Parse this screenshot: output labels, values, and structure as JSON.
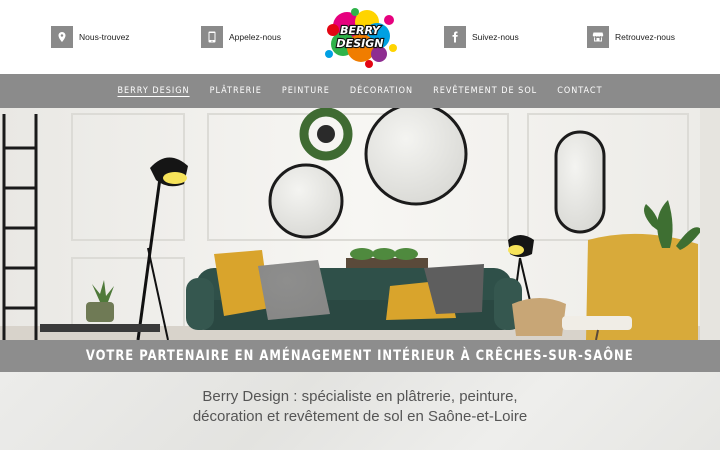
{
  "header": {
    "contacts": [
      {
        "label": "Nous-trouvez",
        "icon": "map-pin-icon"
      },
      {
        "label": "Appelez-nous",
        "icon": "phone-icon"
      },
      {
        "label": "Suivez-nous",
        "icon": "facebook-icon"
      },
      {
        "label": "Retrouvez-nous",
        "icon": "storefront-icon"
      }
    ],
    "logo_text": "BERRY DESIGN"
  },
  "nav": {
    "items": [
      {
        "label": "Berry Design",
        "active": true
      },
      {
        "label": "Plâtrerie",
        "active": false
      },
      {
        "label": "Peinture",
        "active": false
      },
      {
        "label": "Décoration",
        "active": false
      },
      {
        "label": "Revêtement de sol",
        "active": false
      },
      {
        "label": "Contact",
        "active": false
      }
    ]
  },
  "banner": {
    "title": "Votre partenaire en aménagement intérieur à Crêches-sur-Saône"
  },
  "intro": {
    "line1": "Berry Design : spécialiste en plâtrerie, peinture,",
    "line2": "décoration et revêtement de sol en Saône-et-Loire"
  },
  "colors": {
    "nav_bg": "#8b8b8b",
    "banner_bg": "#8d8d8d",
    "icon_bg": "#8a8a8a",
    "sofa": "#2f5049",
    "cushion_yellow": "#d9a42c",
    "armchair": "#d8aa3a"
  }
}
